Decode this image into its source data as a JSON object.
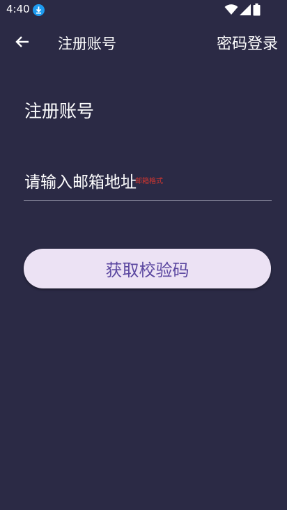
{
  "status_bar": {
    "time": "4:40",
    "icons": [
      "download-icon",
      "wifi-icon",
      "signal-icon",
      "battery-icon"
    ]
  },
  "app_bar": {
    "title": "注册账号",
    "action_label": "密码登录",
    "back_icon": "arrow-left-icon"
  },
  "form": {
    "heading": "注册账号",
    "email_placeholder": "请输入邮箱地址",
    "email_value": "",
    "error_text": "邮箱格式",
    "submit_label": "获取校验码"
  },
  "colors": {
    "background": "#2b2a45",
    "button_bg": "#ece2f4",
    "button_text": "#5b47a0",
    "error": "#d6362f",
    "underline": "#8c8ca0"
  }
}
